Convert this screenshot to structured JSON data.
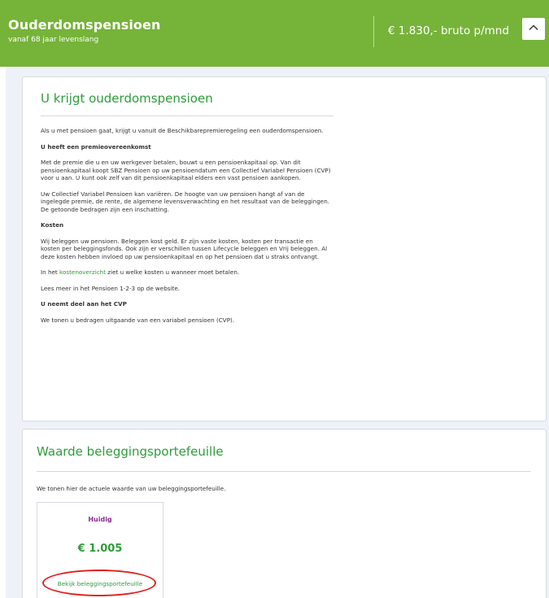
{
  "header": {
    "title": "Ouderdomspensioen",
    "subtitle": "vanaf 68 jaar levenslang",
    "amount": "€ 1.830,- bruto p/mnd",
    "collapse_icon": "chevron-up-icon",
    "color": "#76b339"
  },
  "card1": {
    "title": "U krijgt ouderdomspensioen",
    "p1": "Als u met pensioen gaat, krijgt u vanuit de Beschikbarepremieregeling een ouderdomspensioen.",
    "h1": "U heeft een premieovereenkomst",
    "p2": "Met de premie die u en uw werkgever betalen, bouwt u een pensioenkapitaal op. Van dit pensioenkapitaal koopt SBZ Pensioen op uw pensioendatum een Collectief Variabel Pensioen (CVP) voor u aan. U kunt ook zelf van dit pensioenkapitaal elders een vast pensioen aankopen.",
    "p3": "Uw Collectief Variabel Pensioen kan variëren. De hoogte van uw pensioen hangt af van de ingelegde premie, de rente, de algemene levensverwachting en het resultaat van de beleggingen. De getoonde bedragen zijn een inschatting.",
    "h2": "Kosten",
    "p4": "Wij beleggen uw pensioen. Beleggen kost geld. Er zijn vaste kosten, kosten per transactie en kosten per beleggingsfonds. Ook zijn er verschillen tussen Lifecycle beleggen en Vrij beleggen. Al deze kosten hebben invloed op uw pensioenkapitaal en op het pensioen dat u straks ontvangt.",
    "p5_before": "In het ",
    "p5_link": "kostenoverzicht",
    "p5_after": " ziet u welke kosten u wanneer moet betalen.",
    "p6": "Lees meer in het Pensioen 1-2-3 op de website.",
    "h3": "U neemt deel aan het CVP",
    "p7": "We tonen u bedragen uitgaande van een variabel pensioen (CVP)."
  },
  "card2": {
    "title": "Waarde beleggingsportefeuille",
    "intro": "We tonen hier de actuele waarde van uw beleggingsportefeuille.",
    "current_label": "Huidig",
    "current_value": "€ 1.005",
    "link_label": "Bekijk beleggingsportefeuille"
  },
  "colors": {
    "accent_green": "#2e9c3a",
    "label_purple": "#8a2b8f",
    "annotation_red": "#e02020"
  }
}
